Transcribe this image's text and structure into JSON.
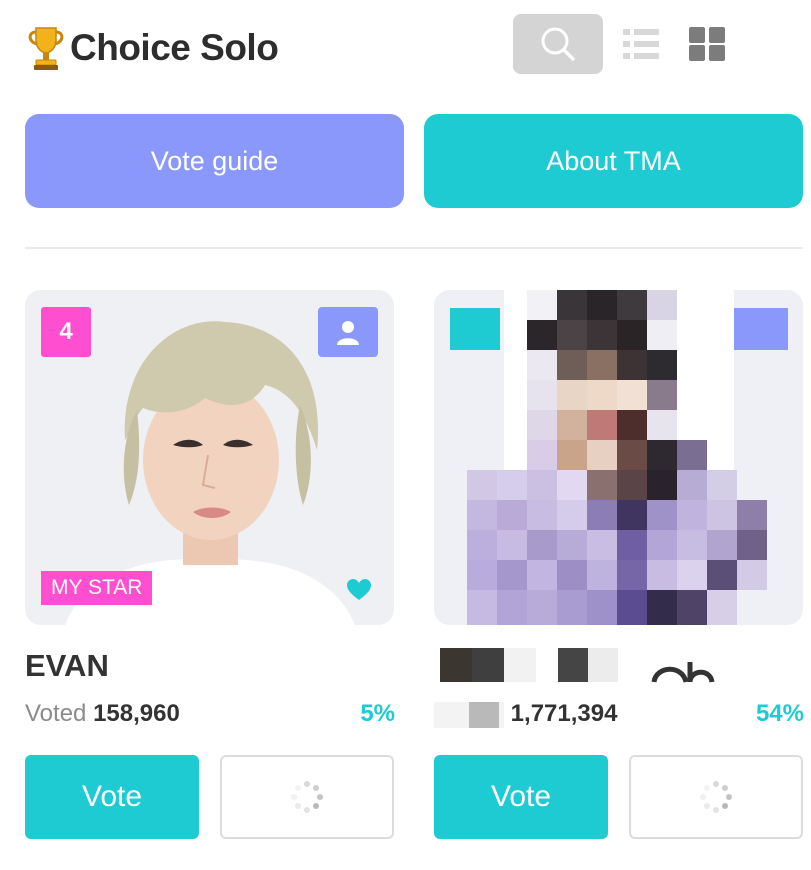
{
  "header": {
    "title": "Choice Solo",
    "trophy_icon": "trophy-icon",
    "search_icon": "search-icon",
    "list_icon": "list-view-icon",
    "grid_icon": "grid-view-icon"
  },
  "actions": {
    "vote_guide": "Vote guide",
    "about": "About TMA"
  },
  "colors": {
    "accent_teal": "#1fcbd3",
    "accent_purple": "#8b98fb",
    "pink": "#ff4fd0"
  },
  "cards": [
    {
      "rank": "4",
      "name": "EVAN",
      "voted_label": "Voted",
      "votes": "158,960",
      "percent": "5%",
      "badge": "MY STAR",
      "vote_label": "Vote"
    },
    {
      "votes": "1,771,394",
      "percent": "54%",
      "vote_label": "Vote"
    }
  ]
}
